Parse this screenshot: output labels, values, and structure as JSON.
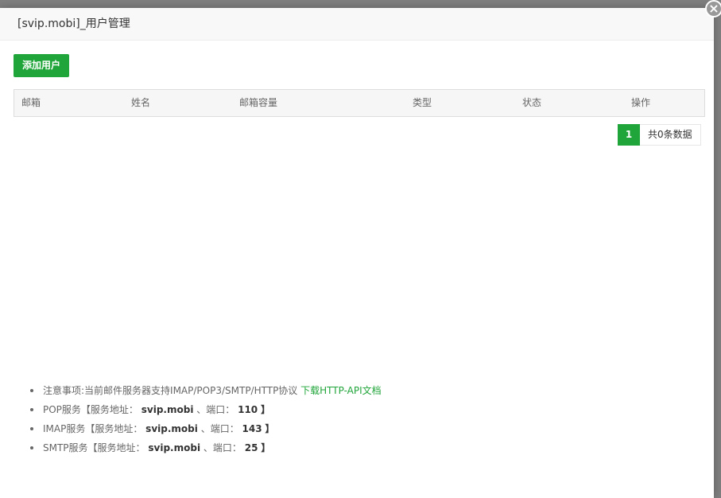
{
  "dialog": {
    "title": "[svip.mobi]_用户管理",
    "close_glyph": "×"
  },
  "toolbar": {
    "add_user_label": "添加用户"
  },
  "table": {
    "columns": [
      "邮箱",
      "姓名",
      "邮箱容量",
      "类型",
      "状态",
      "操作"
    ],
    "rows": []
  },
  "pagination": {
    "current_page": "1",
    "total_text": "共0条数据"
  },
  "notes": {
    "note1_text": "注意事项:当前邮件服务器支持IMAP/POP3/SMTP/HTTP协议",
    "note1_link": "下载HTTP-API文档",
    "pop": {
      "prefix": "POP服务【服务地址：",
      "host": "svip.mobi",
      "port_label": "、端口：",
      "port": "110",
      "suffix": "】"
    },
    "imap": {
      "prefix": "IMAP服务【服务地址：",
      "host": "svip.mobi",
      "port_label": "、端口：",
      "port": "143",
      "suffix": "】"
    },
    "smtp": {
      "prefix": "SMTP服务【服务地址：",
      "host": "svip.mobi",
      "port_label": "、端口：",
      "port": "25",
      "suffix": "】"
    }
  },
  "colors": {
    "accent": "#20a53a",
    "overlay": "#7f7f7f",
    "header_bg": "#f8f8f8"
  }
}
